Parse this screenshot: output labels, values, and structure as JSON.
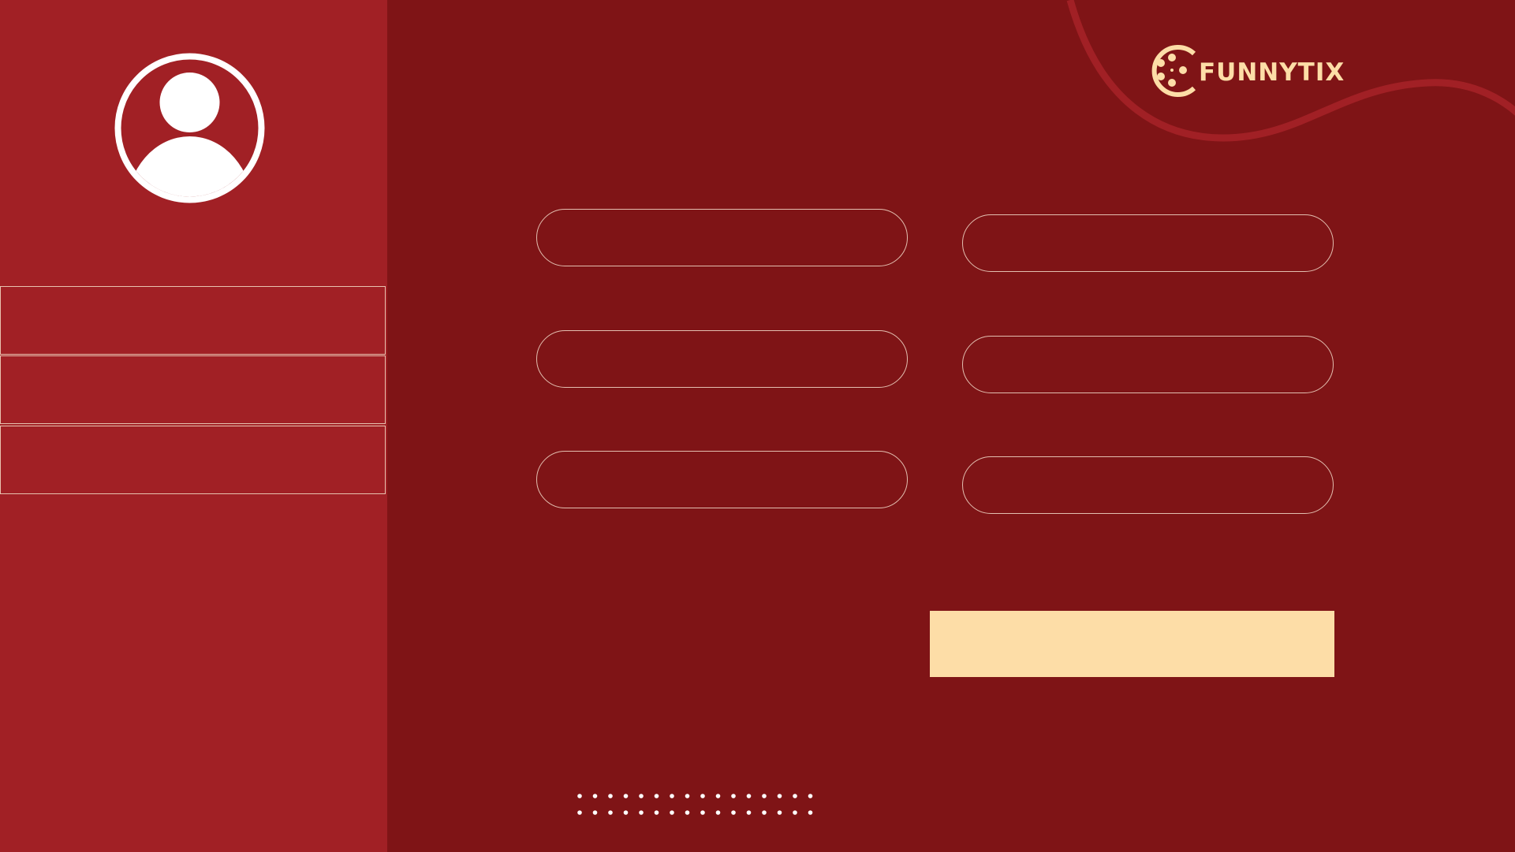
{
  "brand": {
    "name": "FUNNYTIX",
    "logo_icon": "film-reel-icon",
    "color": "#fddda7"
  },
  "sidebar": {
    "avatar_icon": "user-avatar-icon",
    "items": [
      {
        "label": ""
      },
      {
        "label": ""
      },
      {
        "label": ""
      }
    ]
  },
  "form": {
    "fields": [
      {
        "value": "",
        "placeholder": ""
      },
      {
        "value": "",
        "placeholder": ""
      },
      {
        "value": "",
        "placeholder": ""
      },
      {
        "value": "",
        "placeholder": ""
      },
      {
        "value": "",
        "placeholder": ""
      },
      {
        "value": "",
        "placeholder": ""
      }
    ],
    "submit_label": ""
  },
  "colors": {
    "sidebar_bg": "#a12025",
    "main_bg": "#7f1416",
    "accent": "#fddda7",
    "outline": "#e3bfb0"
  }
}
